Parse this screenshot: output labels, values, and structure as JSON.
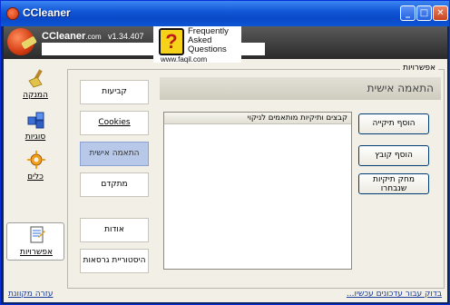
{
  "window": {
    "title": "CCleaner"
  },
  "header": {
    "app_name": "CCleaner",
    "app_suffix": ".com",
    "version": "v1.34.407"
  },
  "watermark": {
    "badge": "?",
    "line1": "Frequently",
    "line2": "Asked",
    "line3": "Questions",
    "url": "www.faqil.com"
  },
  "nav": {
    "items": [
      {
        "label": "המנקה",
        "icon": "broom-icon"
      },
      {
        "label": "סוגיות",
        "icon": "registry-cubes-icon"
      },
      {
        "label": "כלים",
        "icon": "tools-icon"
      },
      {
        "label": "אפשרויות",
        "icon": "options-document-icon"
      }
    ]
  },
  "options": {
    "group_title": "אפשרויות",
    "tabs": [
      {
        "label": "קביעות"
      },
      {
        "label": "Cookies"
      },
      {
        "label": "התאמה אישית"
      },
      {
        "label": "מתקדם"
      },
      {
        "label": "אודות"
      },
      {
        "label": "היסטוריית גרסאות"
      }
    ]
  },
  "panel": {
    "title": "התאמה אישית",
    "list_header": "קבצים ותיקיות מותאמים לניקוי"
  },
  "buttons": {
    "add_folder": "הוסף תיקייה",
    "add_file": "הוסף קובץ",
    "delete_line1": "מחק תיקיות",
    "delete_line2": "שנבחרו"
  },
  "footer": {
    "help": "עזרה מקוונת",
    "update": "...בדוק עבור עדכונים עכשיו"
  }
}
